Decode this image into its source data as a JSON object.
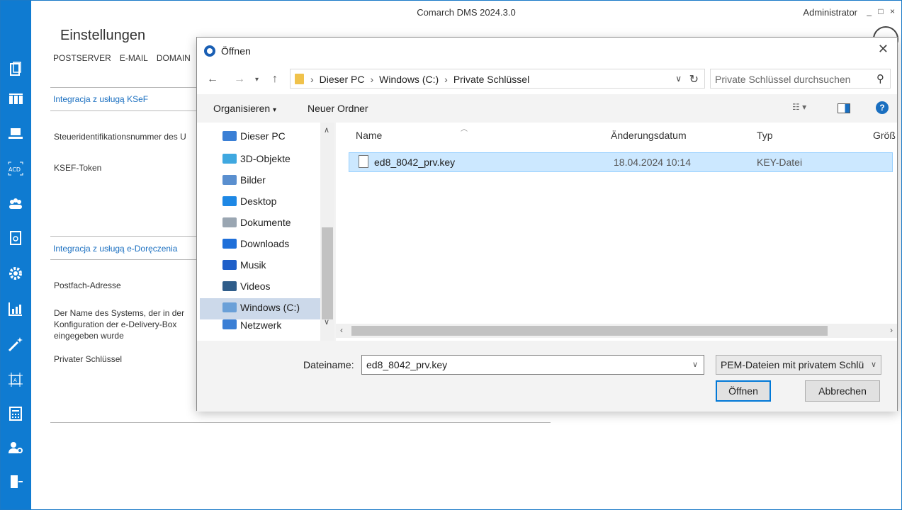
{
  "window": {
    "title": "Comarch DMS 2024.3.0",
    "user": "Administrator",
    "controls": "_ □ ×"
  },
  "settings": {
    "title": "Einstellungen",
    "menu": [
      "POSTSERVER",
      "E-MAIL",
      "DOMAIN"
    ],
    "ksef_section": "Integracja z usługą KSeF",
    "ksef_tax_id": "Steueridentifikationsnummer des U",
    "ksef_token": "KSEF-Token",
    "edelivery_section": "Integracja z usługą e-Doręczenia",
    "mailbox_address": "Postfach-Adresse",
    "system_name": "Der Name des Systems, der in der Konfiguration der e-Delivery-Box eingegeben wurde",
    "private_key": "Privater Schlüssel"
  },
  "dialog": {
    "title": "Öffnen",
    "path": [
      "Dieser PC",
      "Windows (C:)",
      "Private Schlüssel"
    ],
    "search_placeholder": "Private Schlüssel durchsuchen",
    "organize": "Organisieren",
    "new_folder": "Neuer Ordner",
    "tree": [
      {
        "label": "Dieser PC",
        "icon": "computer-icon",
        "color": "#3a7fd5"
      },
      {
        "label": "3D-Objekte",
        "icon": "cube-icon",
        "color": "#3fa8e0"
      },
      {
        "label": "Bilder",
        "icon": "pictures-icon",
        "color": "#5a8fcf"
      },
      {
        "label": "Desktop",
        "icon": "desktop-icon",
        "color": "#1e88e5"
      },
      {
        "label": "Dokumente",
        "icon": "documents-icon",
        "color": "#9aa6b2"
      },
      {
        "label": "Downloads",
        "icon": "downloads-icon",
        "color": "#1e6fd9"
      },
      {
        "label": "Musik",
        "icon": "music-icon",
        "color": "#1e5fc9"
      },
      {
        "label": "Videos",
        "icon": "videos-icon",
        "color": "#2f5d8a"
      },
      {
        "label": "Windows (C:)",
        "icon": "drive-icon",
        "color": "#6aa0d8"
      },
      {
        "label": "Netzwerk",
        "icon": "network-icon",
        "color": "#3a7fd5"
      }
    ],
    "columns": [
      "Name",
      "Änderungsdatum",
      "Typ",
      "Größ"
    ],
    "files": [
      {
        "name": "ed8_8042_prv.key",
        "date": "18.04.2024 10:14",
        "type": "KEY-Datei"
      }
    ],
    "filename_label": "Dateiname:",
    "filename_value": "ed8_8042_prv.key",
    "filetype": "PEM-Dateien mit privatem Schlü",
    "open": "Öffnen",
    "cancel": "Abbrechen"
  }
}
